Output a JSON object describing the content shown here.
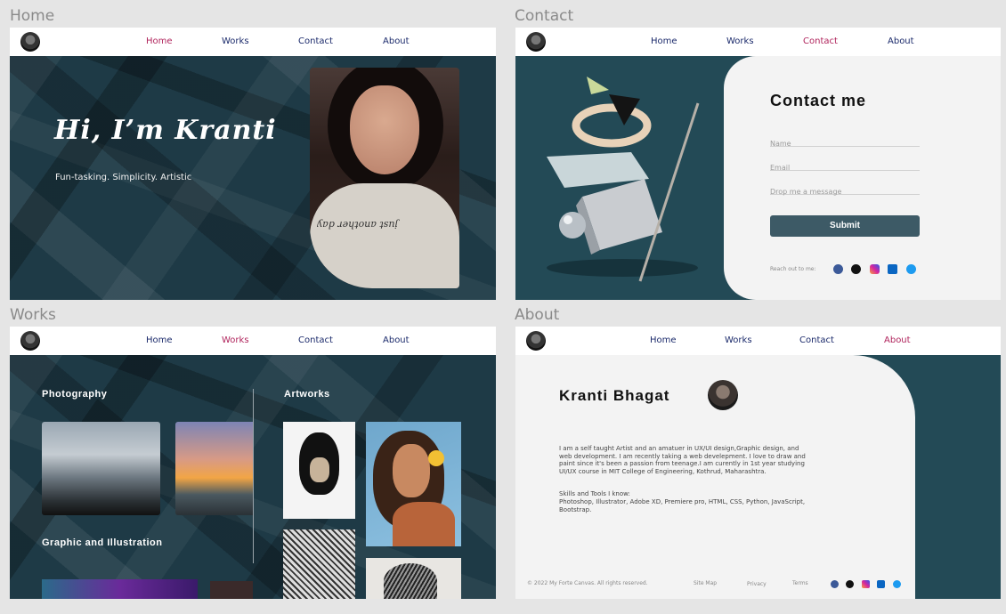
{
  "frames": {
    "home": {
      "label": "Home"
    },
    "contact": {
      "label": "Contact"
    },
    "works": {
      "label": "Works"
    },
    "about": {
      "label": "About"
    }
  },
  "nav": {
    "home": "Home",
    "works": "Works",
    "contact": "Contact",
    "about": "About"
  },
  "home": {
    "headline": "Hi, I’m Kranti",
    "tagline": "Fun-tasking. Simplicity. Artistic",
    "shirt_text": "just another day"
  },
  "contact": {
    "title": "Contact me",
    "name_placeholder": "Name",
    "email_placeholder": "Email",
    "message_placeholder": "Drop me a message",
    "submit": "Submit",
    "reach_out": "Reach out to me:"
  },
  "works": {
    "photography": "Photography",
    "artworks": "Artworks",
    "graphic": "Graphic and Illustration"
  },
  "about": {
    "name": "Kranti Bhagat",
    "bio": "I am a self taught Artist and an amatuer in UX/UI design,Graphic design, and web development. I am recently taking a web develepment. I love to draw and paint since it's been a passion from teenage.I am curently in 1st year studying UI/UX course in MIT College of Engineering, Kothrud, Maharashtra.",
    "skills_heading": "Skills and Tools I know:",
    "skills": "Photoshop, Illustrator, Adobe XD,  Premiere pro, HTML, CSS, Python, JavaScript, Bootstrap.",
    "copyright": "© 2022 My Forte Canvas. All rights reserved.",
    "sitemap": "Site Map",
    "privacy": "Privacy",
    "terms": "Terms"
  },
  "icons": {
    "facebook": "facebook-icon",
    "behance": "behance-icon",
    "instagram": "instagram-icon",
    "linkedin": "linkedin-icon",
    "twitter": "twitter-icon"
  },
  "colors": {
    "nav_link": "#1b2a6b",
    "nav_active": "#b0245c",
    "teal": "#234a56",
    "panel": "#f3f3f3",
    "submit": "#3d5a66"
  }
}
